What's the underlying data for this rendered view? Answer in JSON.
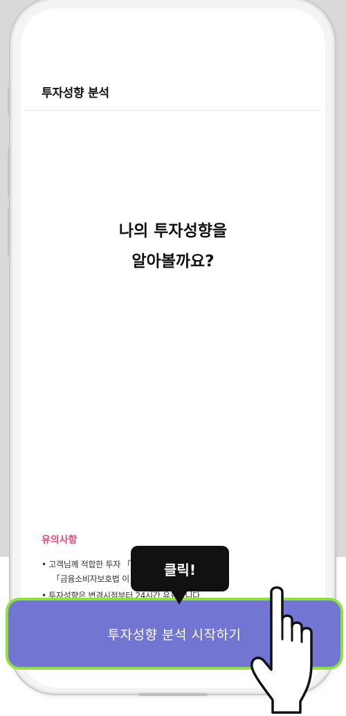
{
  "app": {
    "title": "투자성향 분석"
  },
  "main": {
    "headline_line1": "나의 투자성향을",
    "headline_line2": "알아볼까요?"
  },
  "notice": {
    "title": "유의사항",
    "line1": "• 고객님께 적합한 투자                                      「자본시장법」 및",
    "line2": "「금융소비자보호법                                     이 필요합니다.",
    "line3": "• 투자성향은 변경시점부터 24시간 유효합니다"
  },
  "button": {
    "label": "투자성향 분석 시작하기"
  },
  "tooltip": {
    "label": "클릭!"
  },
  "colors": {
    "accent": "#7275d1",
    "highlight_border": "#8fe23d",
    "notice_title": "#e8457e",
    "tooltip_bg": "#111111"
  }
}
